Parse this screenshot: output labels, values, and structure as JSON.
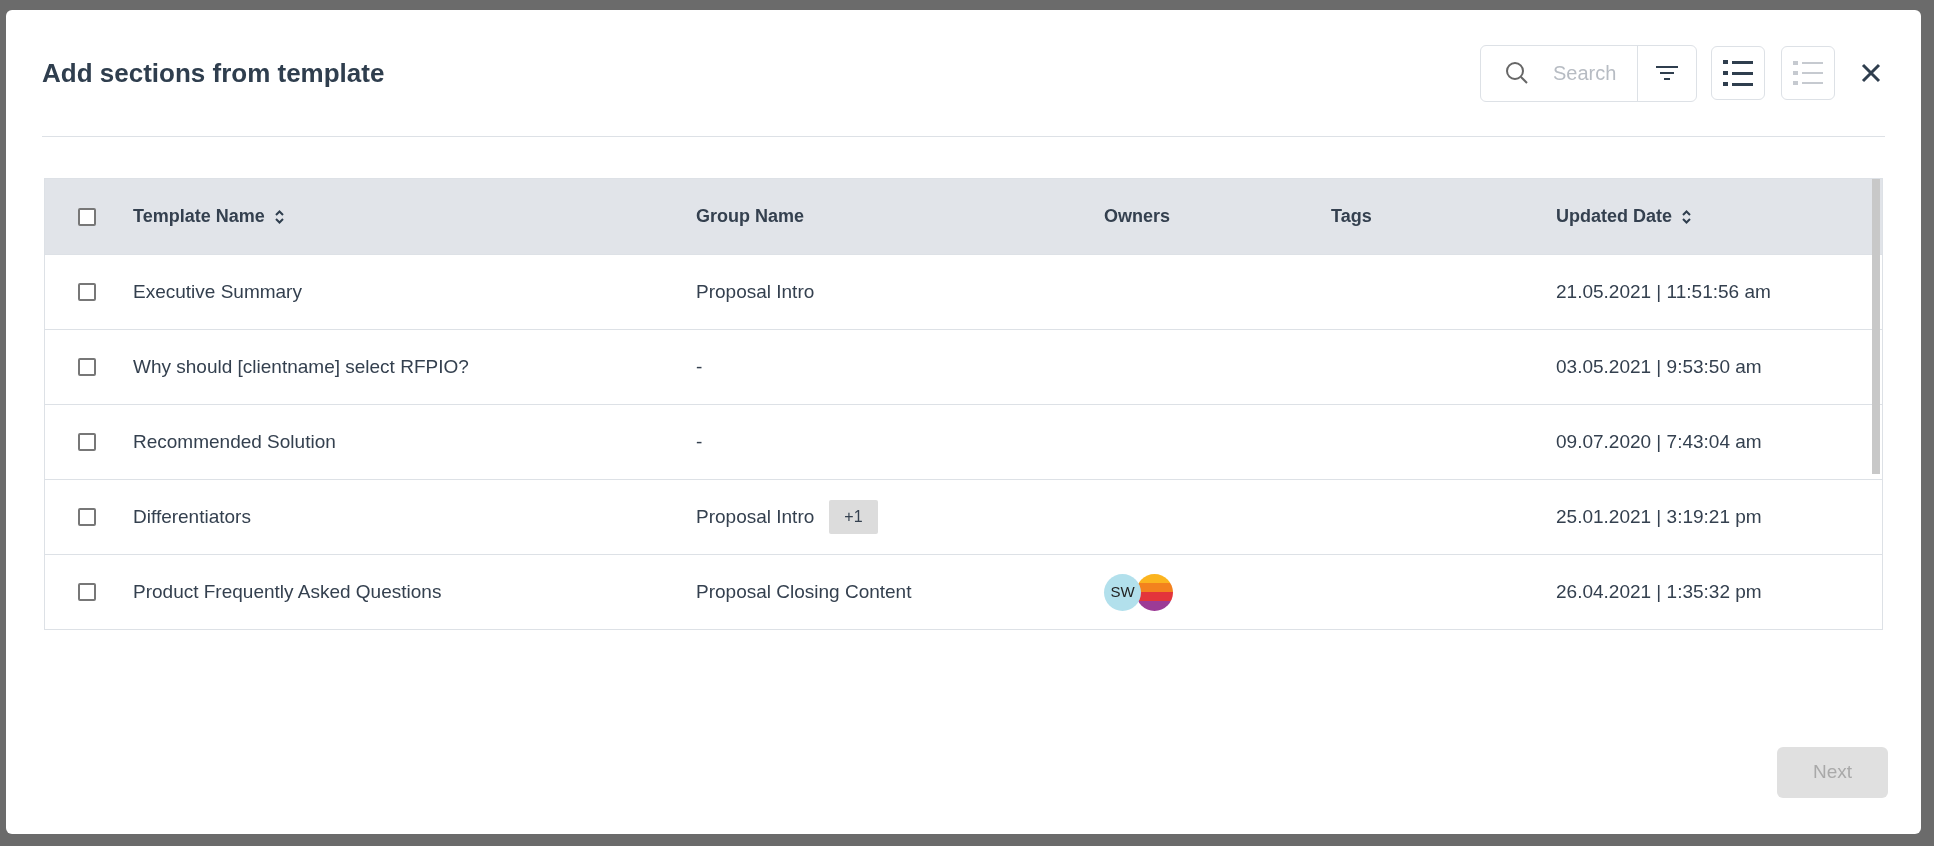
{
  "dialog": {
    "title": "Add sections from template"
  },
  "search": {
    "placeholder": "Search"
  },
  "view_buttons": [
    {
      "kind": "bulleted",
      "selected": true
    },
    {
      "kind": "numbered",
      "selected": false
    }
  ],
  "table": {
    "columns": [
      {
        "label": "Template Name",
        "sortable": true
      },
      {
        "label": "Group Name",
        "sortable": false
      },
      {
        "label": "Owners",
        "sortable": false
      },
      {
        "label": "Tags",
        "sortable": false
      },
      {
        "label": "Updated Date",
        "sortable": true
      }
    ],
    "header_checked": false,
    "rows": [
      {
        "checked": false,
        "name": "Executive Summary",
        "group": "Proposal Intro",
        "updated": "21.05.2021 | 11:51:56 am"
      },
      {
        "checked": false,
        "name": "Why should [clientname] select RFPIO?",
        "group": "-",
        "updated": "03.05.2021 | 9:53:50 am"
      },
      {
        "checked": false,
        "name": "Recommended Solution",
        "group": "-",
        "updated": "09.07.2020 | 7:43:04 am"
      },
      {
        "checked": false,
        "name": "Differentiators",
        "group": "Proposal Intro",
        "group_extra": "+1",
        "updated": "25.01.2021 | 3:19:21 pm"
      },
      {
        "checked": false,
        "name": "Product Frequently Asked Questions",
        "group": "Proposal Closing Content",
        "owners": [
          {
            "kind": "initials",
            "text": "SW"
          },
          {
            "kind": "picture"
          }
        ],
        "updated": "26.04.2021 | 1:35:32 pm"
      }
    ]
  },
  "next_button": {
    "label": "Next",
    "disabled": true
  }
}
